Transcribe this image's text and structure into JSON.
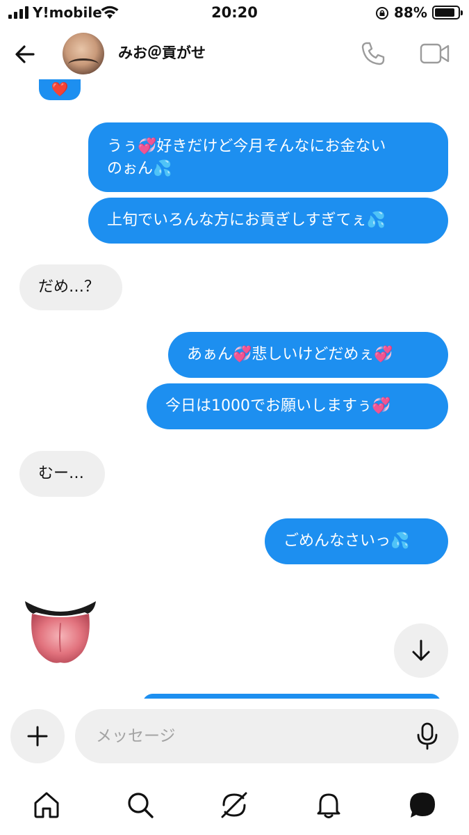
{
  "status_bar": {
    "carrier": "Y!mobile",
    "time": "20:20",
    "battery_percent": "88%",
    "battery_level": 0.88
  },
  "header": {
    "contact_name": "みお＠貢がせ",
    "icons": [
      "back-arrow-icon",
      "avatar",
      "phone-icon",
      "video-camera-icon"
    ]
  },
  "messages": [
    {
      "side": "sent",
      "text": "❤️"
    },
    {
      "side": "sent",
      "line1": "うぅ💞好きだけど今月そんなにお金ない",
      "line2": "のぉん💦"
    },
    {
      "side": "sent",
      "text": "上旬でいろんな方にお貢ぎしすぎてぇ💦"
    },
    {
      "side": "received",
      "text": "だめ…？"
    },
    {
      "side": "sent",
      "text": "あぁん💞悲しいけどだめぇ💞"
    },
    {
      "side": "sent",
      "text": "今日は1000でお願いしますぅ💞"
    },
    {
      "side": "received",
      "text": "むー…"
    },
    {
      "side": "sent",
      "text": "ごめんなさいっ💦"
    },
    {
      "side": "received",
      "sticker": "tongue-emoji"
    }
  ],
  "composer": {
    "placeholder": "メッセージ"
  },
  "bottom_nav": {
    "items": [
      "home-icon",
      "search-icon",
      "explore-icon",
      "notifications-bell-icon",
      "messages-icon"
    ]
  },
  "colors": {
    "sent_bubble": "#1d8ff0",
    "received_bubble": "#efefef",
    "placeholder": "#a3a3a3"
  }
}
